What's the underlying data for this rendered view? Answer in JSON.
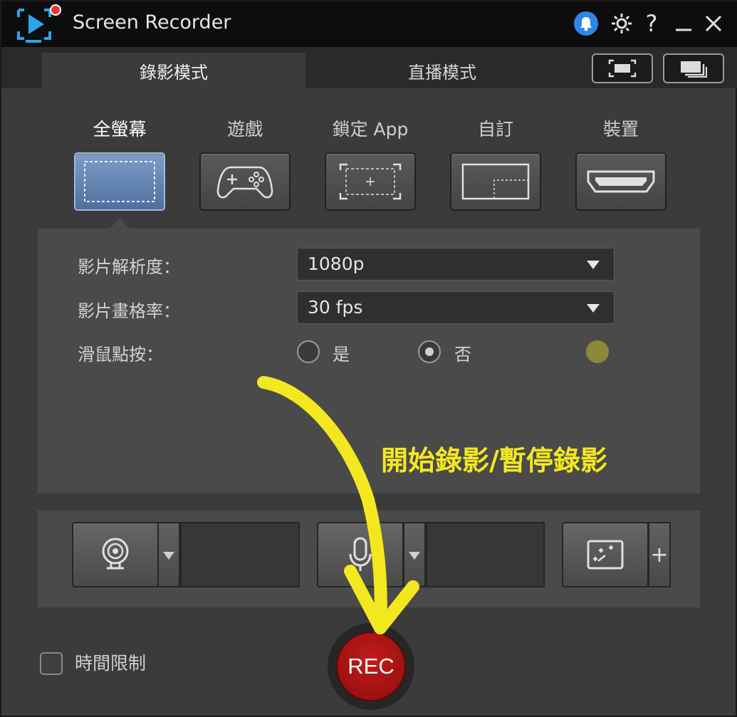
{
  "window": {
    "title": "Screen Recorder",
    "help_glyph": "?",
    "icons": [
      "app-logo-icon",
      "bell-icon",
      "gear-icon",
      "help-icon",
      "minimize-icon",
      "close-icon"
    ]
  },
  "tabs": [
    {
      "label": "錄影模式",
      "active": true
    },
    {
      "label": "直播模式",
      "active": false
    }
  ],
  "view_buttons": [
    "fullscreen-view-icon",
    "window-view-icon"
  ],
  "capture_modes": [
    {
      "label": "全螢幕",
      "icon": "fullscreen-icon",
      "active": true
    },
    {
      "label": "遊戲",
      "icon": "gamepad-icon",
      "active": false
    },
    {
      "label": "鎖定 App",
      "icon": "lock-app-icon",
      "active": false
    },
    {
      "label": "自訂",
      "icon": "custom-region-icon",
      "active": false
    },
    {
      "label": "裝置",
      "icon": "hdmi-device-icon",
      "active": false
    }
  ],
  "settings": {
    "resolution_label": "影片解析度：",
    "resolution_value": "1080p",
    "framerate_label": "影片畫格率：",
    "framerate_value": "30 fps",
    "mouse_click_label": "滑鼠點按：",
    "yes_label": "是",
    "no_label": "否",
    "mouse_click_selected": "否",
    "click_color": "#8c8a3a"
  },
  "devices": {
    "webcam_icon": "webcam-icon",
    "mic_icon": "microphone-icon",
    "effect_icon": "sparkle-effect-icon",
    "add_label": "+"
  },
  "bottom": {
    "time_limit_label": "時間限制",
    "rec_label": "REC"
  },
  "annotation": {
    "text": "開始錄影/暫停錄影",
    "color": "#f3e81f"
  }
}
